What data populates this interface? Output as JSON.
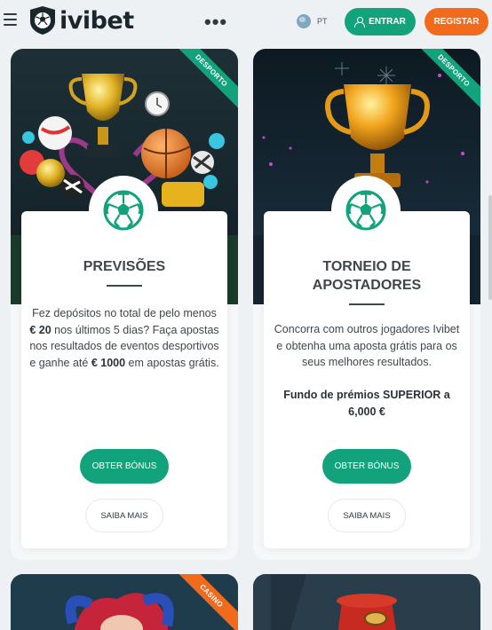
{
  "header": {
    "logo_text": "ivibet",
    "more_label": "•••",
    "language": "PT",
    "login_label": "ENTRAR",
    "register_label": "REGISTAR"
  },
  "promos": [
    {
      "ribbon": "DESPORTO",
      "title": "PREVISÕES",
      "desc_1": "Fez depósitos no total de pelo menos ",
      "desc_amount": "€ 20",
      "desc_2": " nos últimos 5 dias? Faça apostas nos resultados de eventos desportivos e ganhe até ",
      "desc_prize": "€ 1000",
      "desc_3": " em apostas grátis.",
      "primary_button": "OBTER BÓNUS",
      "secondary_button": "SAIBA MAIS"
    },
    {
      "ribbon": "DESPORTO",
      "title_line1": "TORNEIO DE",
      "title_line2": "APOSTADORES",
      "desc": "Concorra com outros jogadores Ivibet e obtenha uma aposta grátis para os seus melhores resultados.",
      "fund": "Fundo de prémios SUPERIOR a 6,000 €",
      "primary_button": "OBTER BÓNUS",
      "secondary_button": "SAIBA MAIS"
    },
    {
      "ribbon": "CASINO"
    },
    {
      "ribbon": ""
    }
  ],
  "colors": {
    "brand_green": "#12a37c",
    "brand_orange": "#f26a1b",
    "page_bg": "#eef1f3"
  }
}
